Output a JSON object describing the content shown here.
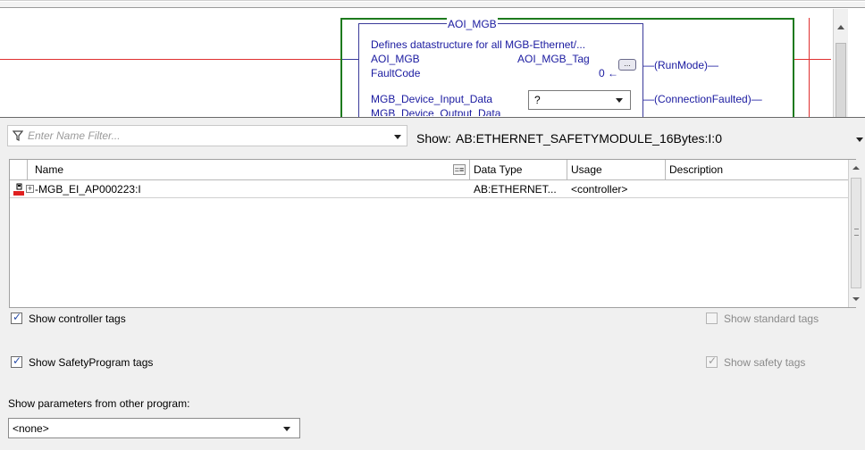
{
  "ladder": {
    "aoi_title": "AOI_MGB",
    "description": "Defines datastructure for all MGB-Ethernet/...",
    "instruction_label": "AOI_MGB",
    "instruction_value": "AOI_MGB_Tag",
    "dots_button": "...",
    "fault_label": "FaultCode",
    "fault_value": "0 ←",
    "input_label": "MGB_Device_Input_Data",
    "input_value": "?",
    "output_label": "MGB_Device_Output_Data",
    "coil_runmode": "—(RunMode)—",
    "coil_connection": "—(ConnectionFaulted)—"
  },
  "filter": {
    "placeholder": "Enter Name Filter..."
  },
  "show": {
    "label": "Show:",
    "value": "AB:ETHERNET_SAFETYMODULE_16Bytes:I:0"
  },
  "grid": {
    "columns": [
      "Name",
      "Data Type",
      "Usage",
      "Description"
    ],
    "rows": [
      {
        "name": "MGB_EI_AP000223:I",
        "data_type": "AB:ETHERNET...",
        "usage": "<controller>",
        "description": ""
      }
    ]
  },
  "options": {
    "controller_tags": {
      "label": "Show controller tags",
      "checked": true
    },
    "standard_tags": {
      "label": "Show standard tags",
      "checked": false
    },
    "safety_program_tags": {
      "label": "Show SafetyProgram tags",
      "checked": true
    },
    "safety_tags": {
      "label": "Show safety tags",
      "checked": true
    }
  },
  "params": {
    "label": "Show parameters from other program:",
    "value": "<none>"
  },
  "colors": {
    "rail": "#e03030",
    "rung": "#1d7a1d",
    "instruction_text": "#1a1aa0",
    "check": "#2a4ea8"
  }
}
